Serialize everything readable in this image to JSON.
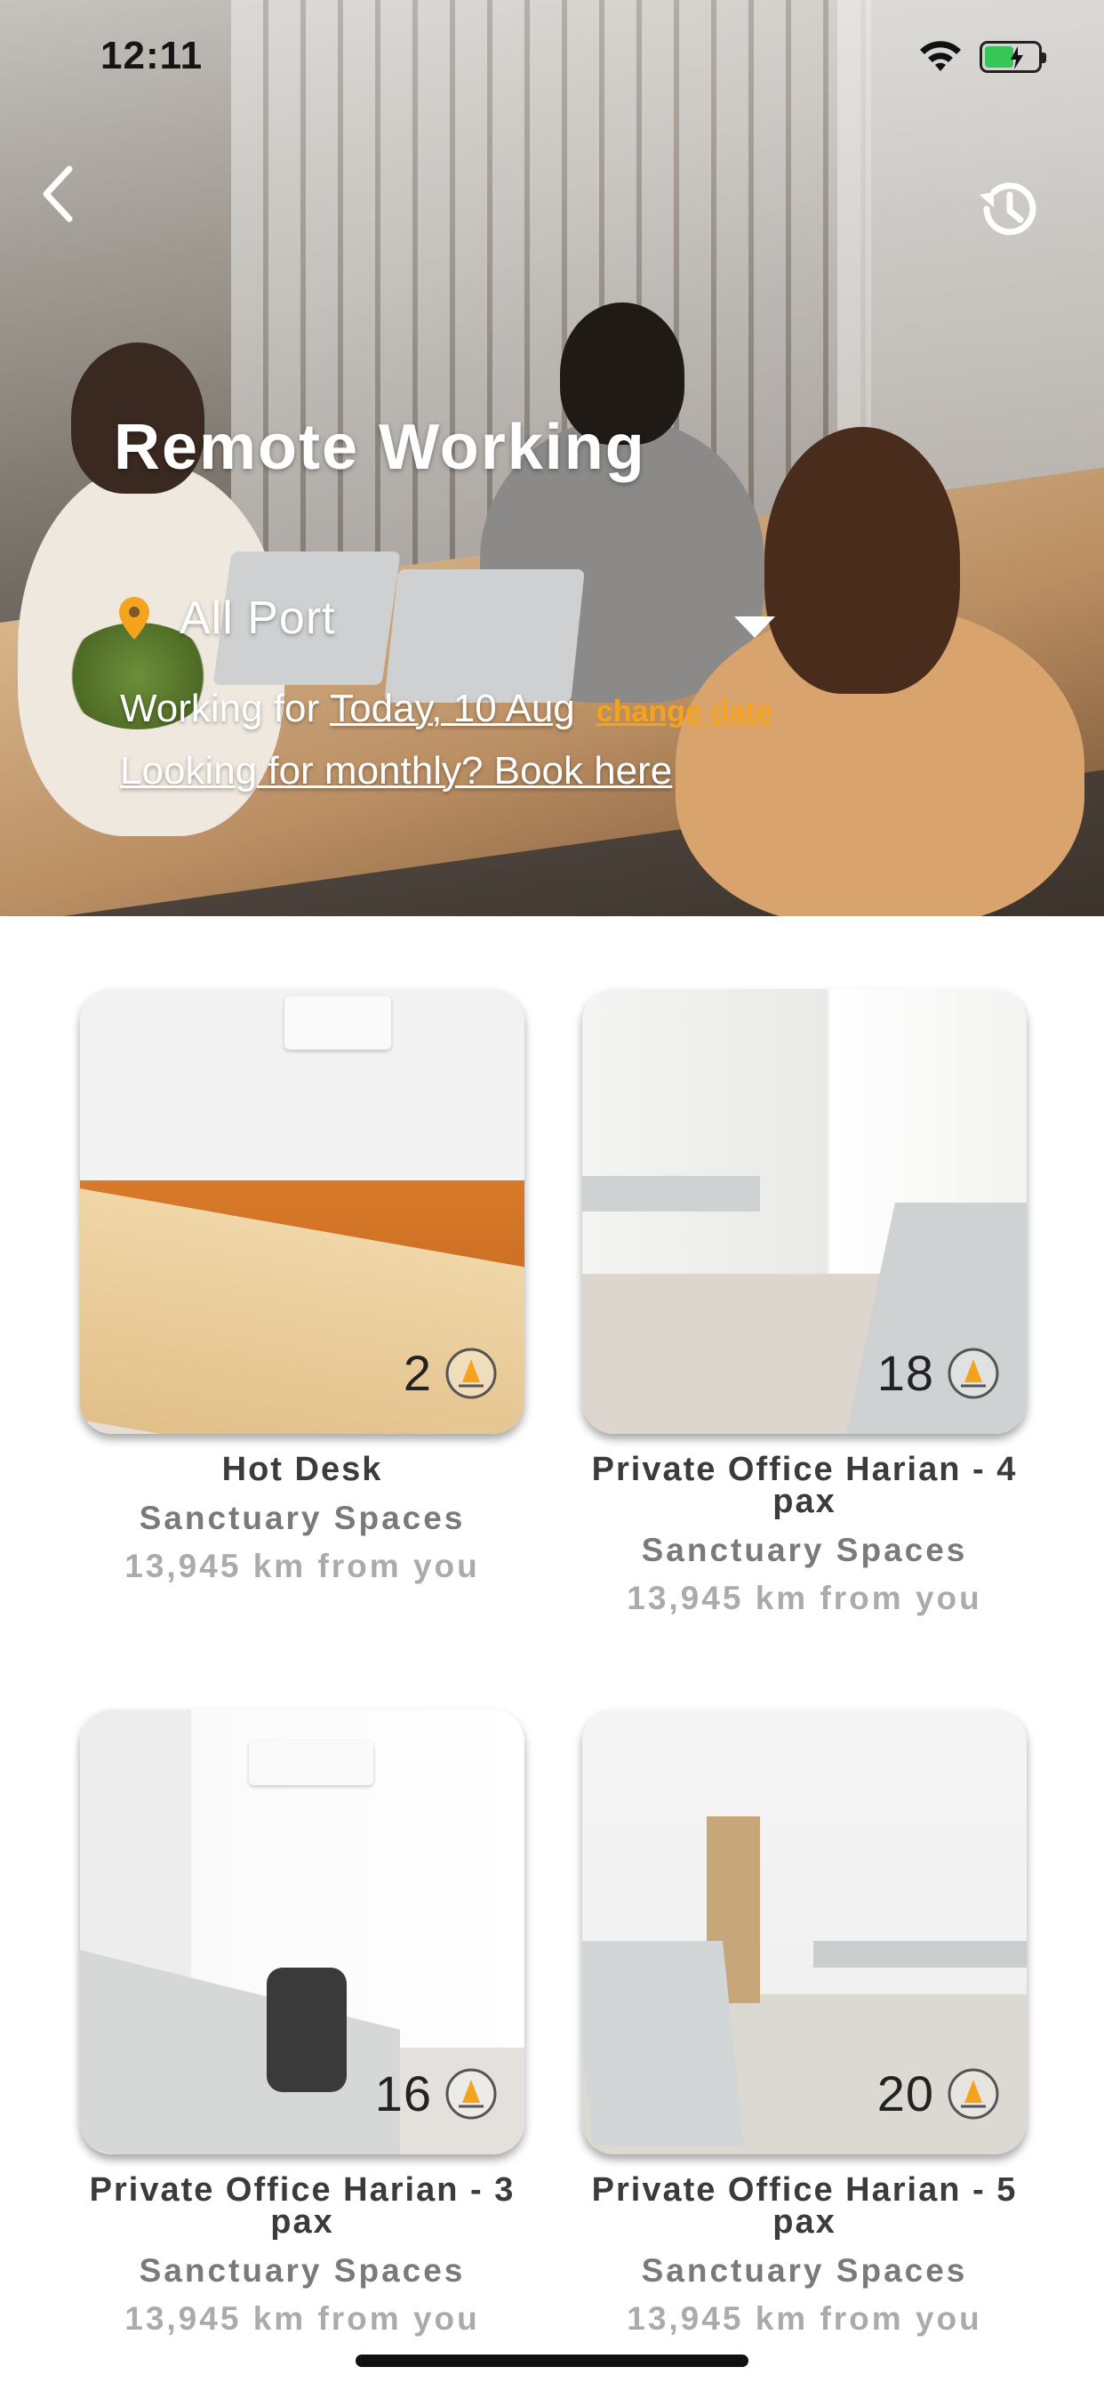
{
  "status_bar": {
    "time": "12:11"
  },
  "header": {
    "title": "Remote Working",
    "location": "All Port",
    "working_label": "Working for",
    "working_date": "Today, 10 Aug",
    "change_date": "change date",
    "monthly_link": "Looking for monthly? Book here"
  },
  "icons": {
    "back": "chevron-left-icon",
    "history": "history-icon",
    "location": "location-pin-icon",
    "dropdown": "triangle-down-icon",
    "coin": "coin-icon"
  },
  "colors": {
    "accent": "#f5a31d",
    "title_text": "#3b3b3b",
    "subtitle_text": "#7a7a7a",
    "distance_text": "#ababab"
  },
  "listings": [
    {
      "title": "Hot Desk",
      "vendor": "Sanctuary Spaces",
      "distance": "13,945 km from you",
      "count": "2"
    },
    {
      "title": "Private Office Harian - 4 pax",
      "vendor": "Sanctuary Spaces",
      "distance": "13,945 km from you",
      "count": "18"
    },
    {
      "title": "Private Office Harian - 3 pax",
      "vendor": "Sanctuary Spaces",
      "distance": "13,945 km from you",
      "count": "16"
    },
    {
      "title": "Private Office Harian - 5 pax",
      "vendor": "Sanctuary Spaces",
      "distance": "13,945 km from you",
      "count": "20"
    }
  ]
}
